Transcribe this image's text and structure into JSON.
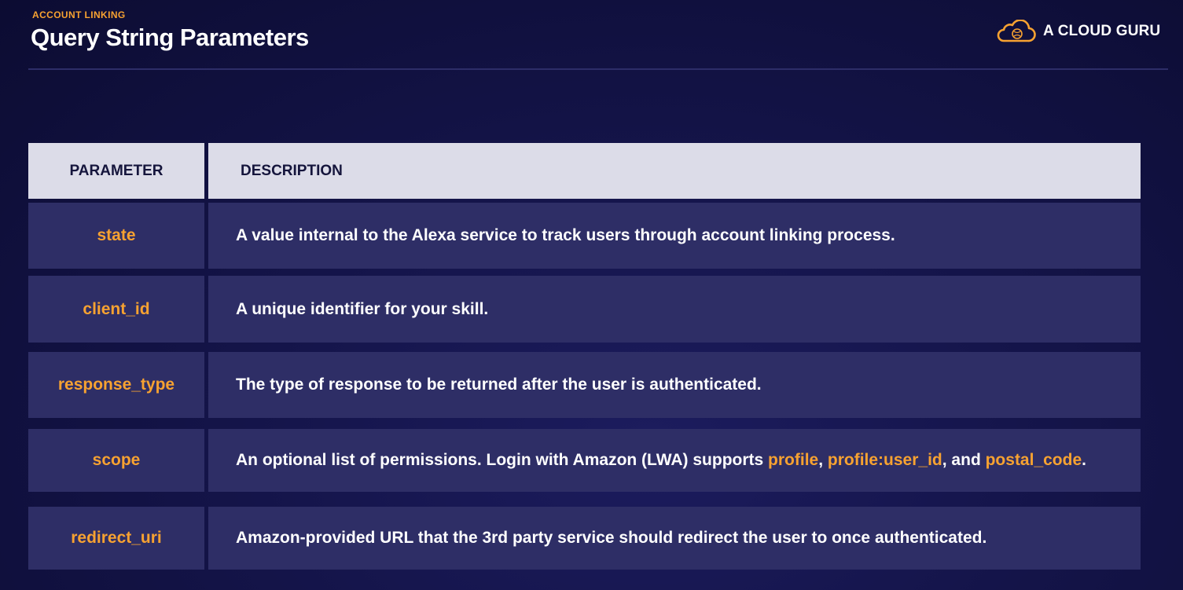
{
  "header": {
    "eyebrow": "ACCOUNT LINKING",
    "title": "Query String Parameters",
    "brand": "A CLOUD GURU"
  },
  "colors": {
    "accent": "#f7a231",
    "background": "#141449",
    "row_background": "#2e2e66",
    "header_background": "#dcdce8"
  },
  "icons": {
    "brand_logo": "cloud-logo-icon"
  },
  "table": {
    "headers": {
      "parameter": "PARAMETER",
      "description": "DESCRIPTION"
    },
    "rows": [
      {
        "parameter": "state",
        "description": "A value internal to the Alexa service to track users through account linking process."
      },
      {
        "parameter": "client_id",
        "description": "A unique identifier for your skill."
      },
      {
        "parameter": "response_type",
        "description": "The type of response to be returned after the user is authenticated."
      },
      {
        "parameter": "scope",
        "description_parts": {
          "intro": "An optional list of permissions. Login with Amazon (LWA) supports ",
          "scope_1": "profile",
          "sep_1": ", ",
          "scope_2": "profile:user_id",
          "sep_2": ", and ",
          "scope_3": "postal_code",
          "end": "."
        }
      },
      {
        "parameter": "redirect_uri",
        "description": "Amazon-provided URL that the 3rd party service should redirect the user to once authenticated."
      }
    ]
  }
}
